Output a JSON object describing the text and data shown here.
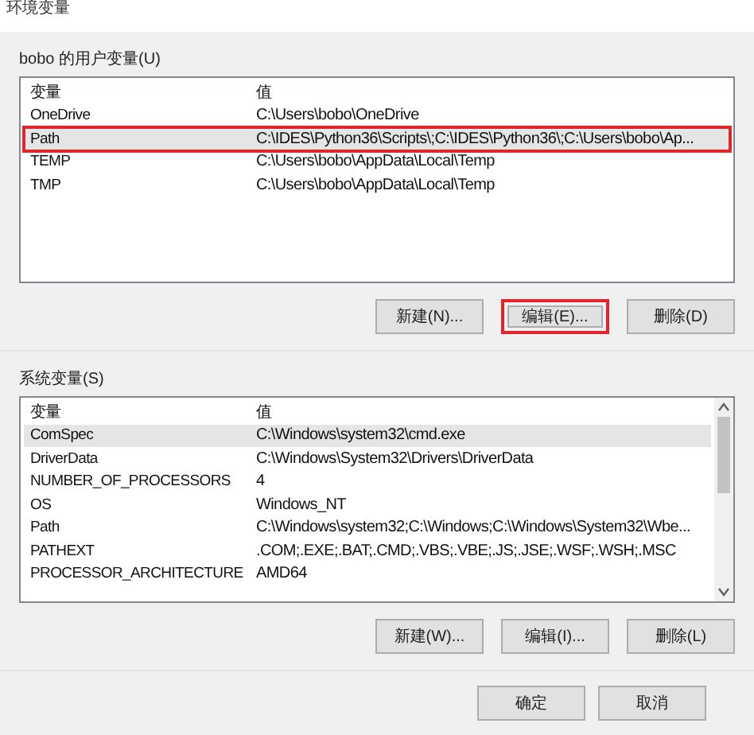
{
  "window": {
    "title": "环境变量"
  },
  "user_vars": {
    "label": "bobo 的用户变量(U)",
    "columns": [
      "变量",
      "值"
    ],
    "rows": [
      {
        "name": "OneDrive",
        "value": "C:\\Users\\bobo\\OneDrive",
        "selected": false,
        "highlighted": false
      },
      {
        "name": "Path",
        "value": "C:\\IDES\\Python36\\Scripts\\;C:\\IDES\\Python36\\;C:\\Users\\bobo\\Ap...",
        "selected": true,
        "highlighted": true
      },
      {
        "name": "TEMP",
        "value": "C:\\Users\\bobo\\AppData\\Local\\Temp",
        "selected": false,
        "highlighted": false
      },
      {
        "name": "TMP",
        "value": "C:\\Users\\bobo\\AppData\\Local\\Temp",
        "selected": false,
        "highlighted": false
      }
    ],
    "buttons": [
      {
        "label": "新建(N)...",
        "highlighted": false
      },
      {
        "label": "编辑(E)...",
        "highlighted": true
      },
      {
        "label": "删除(D)",
        "highlighted": false
      }
    ]
  },
  "system_vars": {
    "label": "系统变量(S)",
    "columns": [
      "变量",
      "值"
    ],
    "rows": [
      {
        "name": "ComSpec",
        "value": "C:\\Windows\\system32\\cmd.exe",
        "selected": true,
        "highlighted": false
      },
      {
        "name": "DriverData",
        "value": "C:\\Windows\\System32\\Drivers\\DriverData",
        "selected": false,
        "highlighted": false
      },
      {
        "name": "NUMBER_OF_PROCESSORS",
        "value": "4",
        "selected": false,
        "highlighted": false
      },
      {
        "name": "OS",
        "value": "Windows_NT",
        "selected": false,
        "highlighted": false
      },
      {
        "name": "Path",
        "value": "C:\\Windows\\system32;C:\\Windows;C:\\Windows\\System32\\Wbe...",
        "selected": false,
        "highlighted": false
      },
      {
        "name": "PATHEXT",
        "value": ".COM;.EXE;.BAT;.CMD;.VBS;.VBE;.JS;.JSE;.WSF;.WSH;.MSC",
        "selected": false,
        "highlighted": false
      },
      {
        "name": "PROCESSOR_ARCHITECTURE",
        "value": "AMD64",
        "selected": false,
        "highlighted": false
      }
    ],
    "buttons": [
      {
        "label": "新建(W)...",
        "highlighted": false
      },
      {
        "label": "编辑(I)...",
        "highlighted": false
      },
      {
        "label": "删除(L)",
        "highlighted": false
      }
    ]
  },
  "footer_buttons": [
    {
      "label": "确定"
    },
    {
      "label": "取消"
    }
  ]
}
